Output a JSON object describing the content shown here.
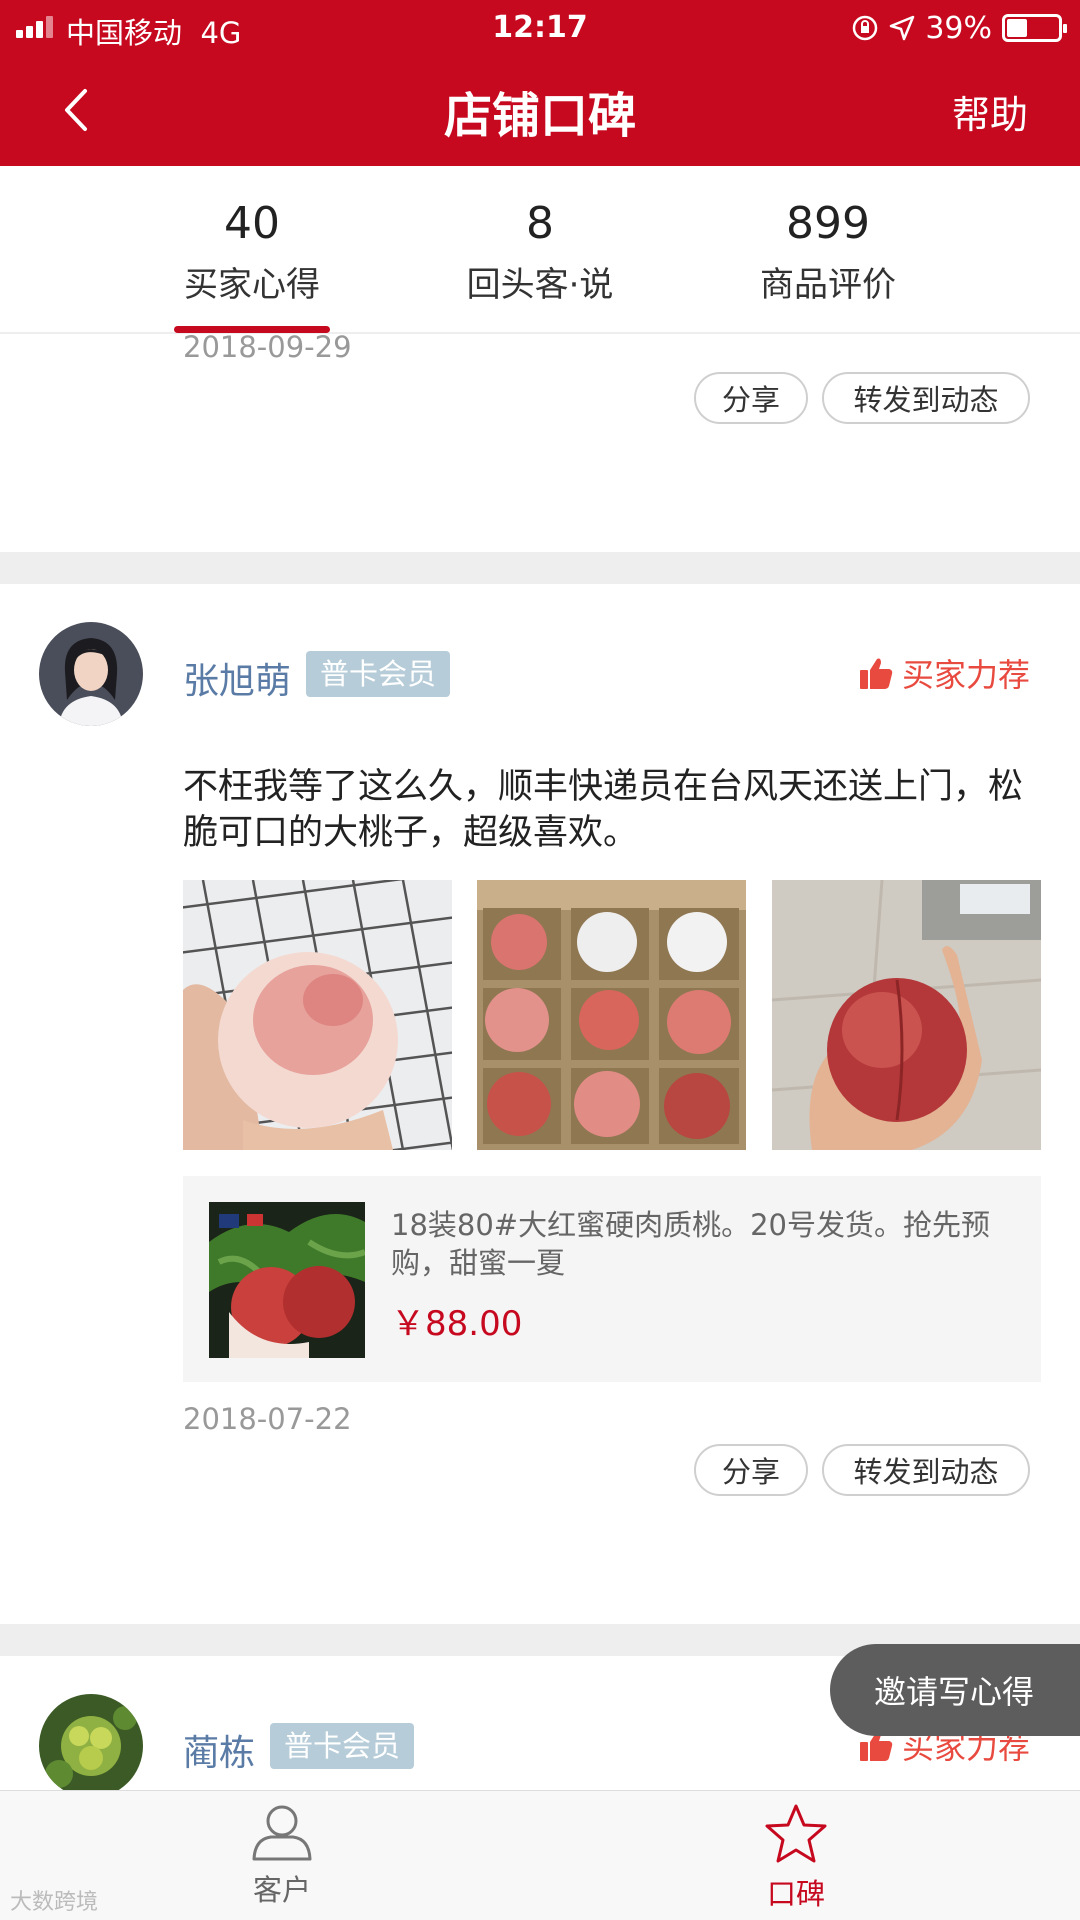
{
  "status_bar": {
    "carrier": "中国移动",
    "network": "4G",
    "time": "12:17",
    "battery": "39%",
    "battery_level": 0.39
  },
  "header": {
    "title": "店铺口碑",
    "help_label": "帮助"
  },
  "tabs": [
    {
      "count": "40",
      "label": "买家心得"
    },
    {
      "count": "8",
      "label": "回头客·说"
    },
    {
      "count": "899",
      "label": "商品评价"
    }
  ],
  "prev_review": {
    "date": "2018-09-29",
    "share_label": "分享",
    "forward_label": "转发到动态"
  },
  "review": {
    "username": "张旭萌",
    "member_badge": "普卡会员",
    "recommend_label": "买家力荐",
    "text": "不枉我等了这么久，顺丰快递员在台风天还送上门，松脆可口的大桃子，超级喜欢。",
    "product": {
      "name": "18装80#大红蜜硬肉质桃。20号发货。抢先预购，甜蜜一夏",
      "price": "￥88.00"
    },
    "date": "2018-07-22",
    "share_label": "分享",
    "forward_label": "转发到动态"
  },
  "next_review": {
    "username": "蔺栋",
    "member_badge": "普卡会员",
    "recommend_label": "买家力荐"
  },
  "invite_label": "邀请写心得",
  "tabbar": [
    {
      "label": "客户"
    },
    {
      "label": "口碑"
    }
  ],
  "watermark": "大数跨境",
  "colors": {
    "brand": "#c6091f",
    "username": "#5a7ba6",
    "badge": "#b6ccd8",
    "recommend": "#e84a3f"
  }
}
